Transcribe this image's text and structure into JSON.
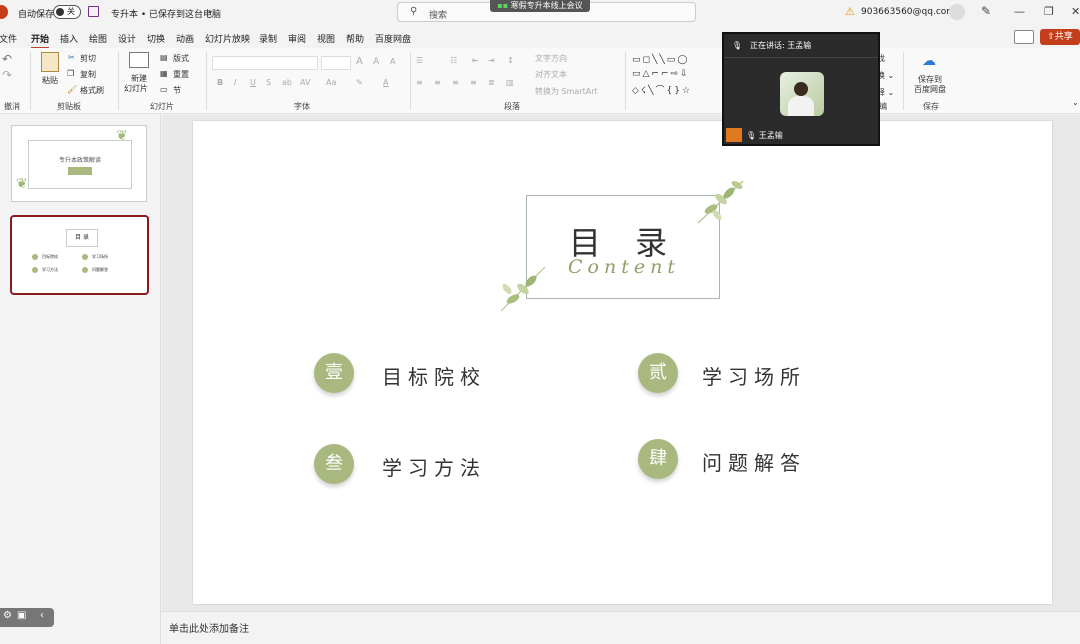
{
  "titlebar": {
    "autosave_label": "自动保存",
    "autosave_state": "关",
    "doc_title": "专升本 • 已保存到这台电脑",
    "search_placeholder": "搜索",
    "meeting_banner": "寒假专升本线上会议",
    "account": "903663560@qq.com"
  },
  "tabs": [
    "文件",
    "开始",
    "插入",
    "绘图",
    "设计",
    "切换",
    "动画",
    "幻灯片放映",
    "录制",
    "审阅",
    "视图",
    "帮助",
    "百度网盘"
  ],
  "share_label": "共享",
  "ribbon": {
    "undo_group": "撤消",
    "clipboard": {
      "paste": "粘贴",
      "cut": "剪切",
      "copy": "复制",
      "format_painter": "格式刷",
      "group": "剪贴板"
    },
    "slides": {
      "new_slide": "新建",
      "new_slide2": "幻灯片",
      "layout": "版式",
      "reset": "重置",
      "section": "节",
      "group": "幻灯片"
    },
    "font": {
      "group": "字体"
    },
    "paragraph": {
      "text_direction": "文字方向",
      "align_text": "对齐文本",
      "smartart": "转换为 SmartArt",
      "group": "段落"
    },
    "drawing": {
      "group": "编"
    },
    "baidu": {
      "save_line1": "保存到",
      "save_line2": "百度网盘",
      "group": "保存"
    }
  },
  "video": {
    "speaking_label": "正在讲话:",
    "speaker": "王孟输",
    "tile_name": "王孟输"
  },
  "slide": {
    "title": "目 录",
    "subtitle": "Content",
    "items": [
      {
        "num": "壹",
        "label": "目标院校"
      },
      {
        "num": "贰",
        "label": "学习场所"
      },
      {
        "num": "叁",
        "label": "学习方法"
      },
      {
        "num": "肆",
        "label": "问题解答"
      }
    ]
  },
  "thumb1": {
    "title": "专升本政策解读"
  },
  "thumb2": {
    "title": "目 录",
    "items": [
      "目标院校",
      "学习场所",
      "学习方法",
      "问题解答"
    ]
  },
  "notes_placeholder": "单击此处添加备注",
  "colors": {
    "accent": "#b7472a",
    "leaf_green": "#a9b87e",
    "share_red": "#c43e1c"
  }
}
